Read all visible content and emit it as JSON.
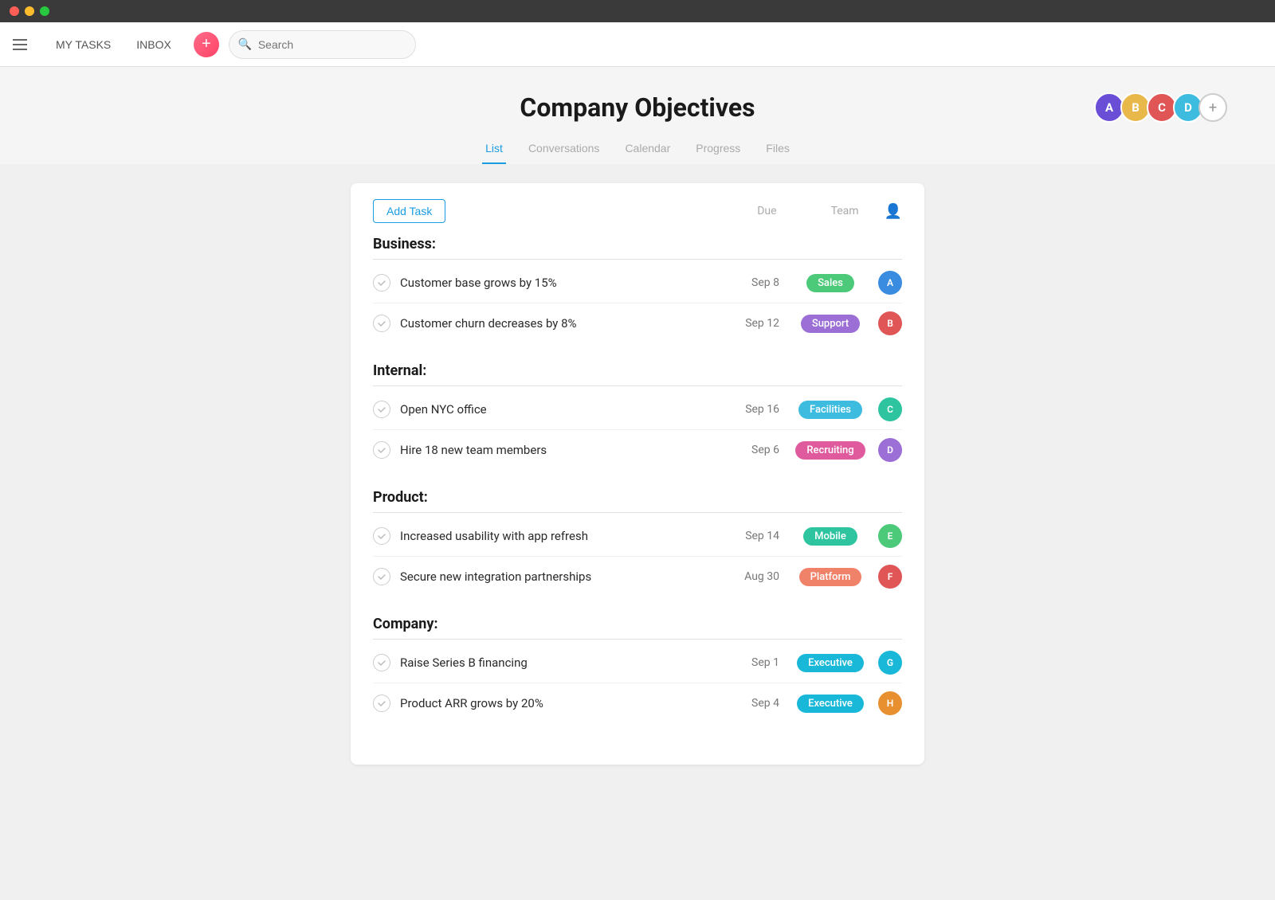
{
  "titleBar": {
    "lights": [
      "red",
      "yellow",
      "green"
    ]
  },
  "topNav": {
    "myTasks": "MY TASKS",
    "inbox": "INBOX",
    "searchPlaceholder": "Search"
  },
  "pageHeader": {
    "title": "Company Objectives",
    "tabs": [
      "List",
      "Conversations",
      "Calendar",
      "Progress",
      "Files"
    ],
    "activeTab": "List"
  },
  "taskArea": {
    "addTaskLabel": "Add Task",
    "colDue": "Due",
    "colTeam": "Team"
  },
  "sections": [
    {
      "title": "Business:",
      "tasks": [
        {
          "name": "Customer base grows by 15%",
          "due": "Sep 8",
          "team": "Sales",
          "teamColor": "badge-green",
          "avatarColor": "av-blue",
          "avatarLabel": "A"
        },
        {
          "name": "Customer churn decreases by 8%",
          "due": "Sep 12",
          "team": "Support",
          "teamColor": "badge-purple",
          "avatarColor": "av-red",
          "avatarLabel": "B"
        }
      ]
    },
    {
      "title": "Internal:",
      "tasks": [
        {
          "name": "Open NYC office",
          "due": "Sep 16",
          "team": "Facilities",
          "teamColor": "badge-blue",
          "avatarColor": "av-teal",
          "avatarLabel": "C"
        },
        {
          "name": "Hire 18 new team members",
          "due": "Sep 6",
          "team": "Recruiting",
          "teamColor": "badge-pink",
          "avatarColor": "av-purple",
          "avatarLabel": "D"
        }
      ]
    },
    {
      "title": "Product:",
      "tasks": [
        {
          "name": "Increased usability with app refresh",
          "due": "Sep 14",
          "team": "Mobile",
          "teamColor": "badge-teal",
          "avatarColor": "av-green",
          "avatarLabel": "E"
        },
        {
          "name": "Secure new integration partnerships",
          "due": "Aug 30",
          "team": "Platform",
          "teamColor": "badge-salmon",
          "avatarColor": "av-red",
          "avatarLabel": "F"
        }
      ]
    },
    {
      "title": "Company:",
      "tasks": [
        {
          "name": "Raise Series B financing",
          "due": "Sep 1",
          "team": "Executive",
          "teamColor": "badge-cyan",
          "avatarColor": "av-cyan",
          "avatarLabel": "G"
        },
        {
          "name": "Product ARR grows by 20%",
          "due": "Sep 4",
          "team": "Executive",
          "teamColor": "badge-cyan",
          "avatarColor": "av-orange",
          "avatarLabel": "H"
        }
      ]
    }
  ],
  "headerAvatars": [
    {
      "color": "#6a4fd6",
      "label": "A"
    },
    {
      "color": "#e8b84b",
      "label": "B"
    },
    {
      "color": "#e05555",
      "label": "C"
    },
    {
      "color": "#3dbce0",
      "label": "D"
    }
  ]
}
